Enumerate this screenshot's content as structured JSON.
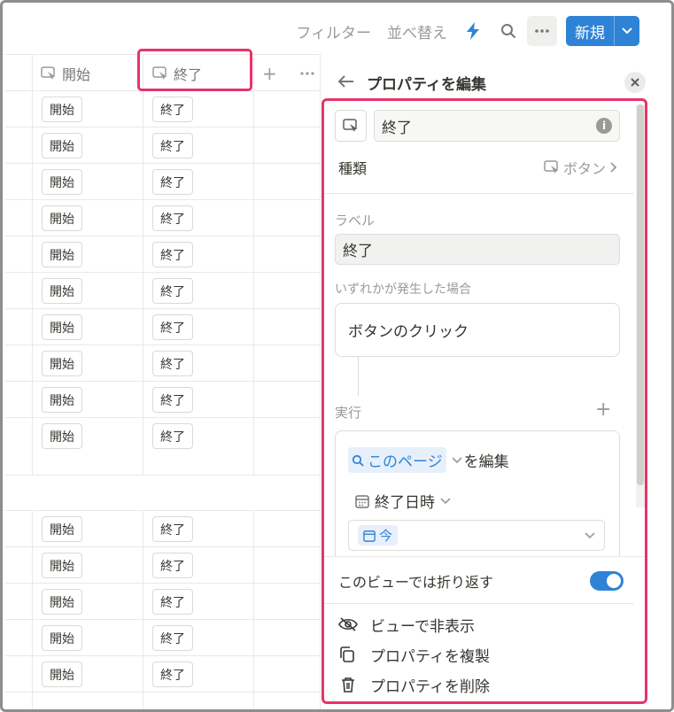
{
  "toolbar": {
    "filter": "フィルター",
    "sort": "並べ替え",
    "new_label": "新規",
    "icons": [
      "lightning-icon",
      "search-icon",
      "more-icon",
      "chevron-down-icon"
    ]
  },
  "table": {
    "columns": [
      "開始",
      "終了"
    ],
    "rows": [
      {
        "start": "開始",
        "end": "終了"
      },
      {
        "start": "開始",
        "end": "終了"
      },
      {
        "start": "開始",
        "end": "終了"
      },
      {
        "start": "開始",
        "end": "終了"
      },
      {
        "start": "開始",
        "end": "終了"
      },
      {
        "start": "開始",
        "end": "終了"
      },
      {
        "start": "開始",
        "end": "終了"
      },
      {
        "start": "開始",
        "end": "終了"
      },
      {
        "start": "開始",
        "end": "終了"
      },
      {
        "start": "開始",
        "end": "終了"
      },
      {
        "start": "開始",
        "end": "終了"
      },
      {
        "start": "開始",
        "end": "終了"
      },
      {
        "start": "開始",
        "end": "終了"
      },
      {
        "start": "開始",
        "end": "終了"
      },
      {
        "start": "開始",
        "end": "終了"
      }
    ]
  },
  "panel": {
    "title": "プロパティを編集",
    "property_name": "終了",
    "type_label": "種類",
    "type_value": "ボタン",
    "label_caption": "ラベル",
    "label_value": "終了",
    "trigger_caption": "いずれかが発生した場合",
    "trigger_value": "ボタンのクリック",
    "execute_caption": "実行",
    "action_target": "このページ",
    "action_suffix": "を編集",
    "action_property": "終了日時",
    "action_value": "今",
    "wrap_label": "このビューでは折り返す",
    "wrap_enabled": true,
    "menu": {
      "hide": "ビューで非表示",
      "duplicate": "プロパティを複製",
      "delete": "プロパティを削除"
    }
  },
  "colors": {
    "accent": "#2f83d6",
    "highlight": "#e8336a"
  }
}
